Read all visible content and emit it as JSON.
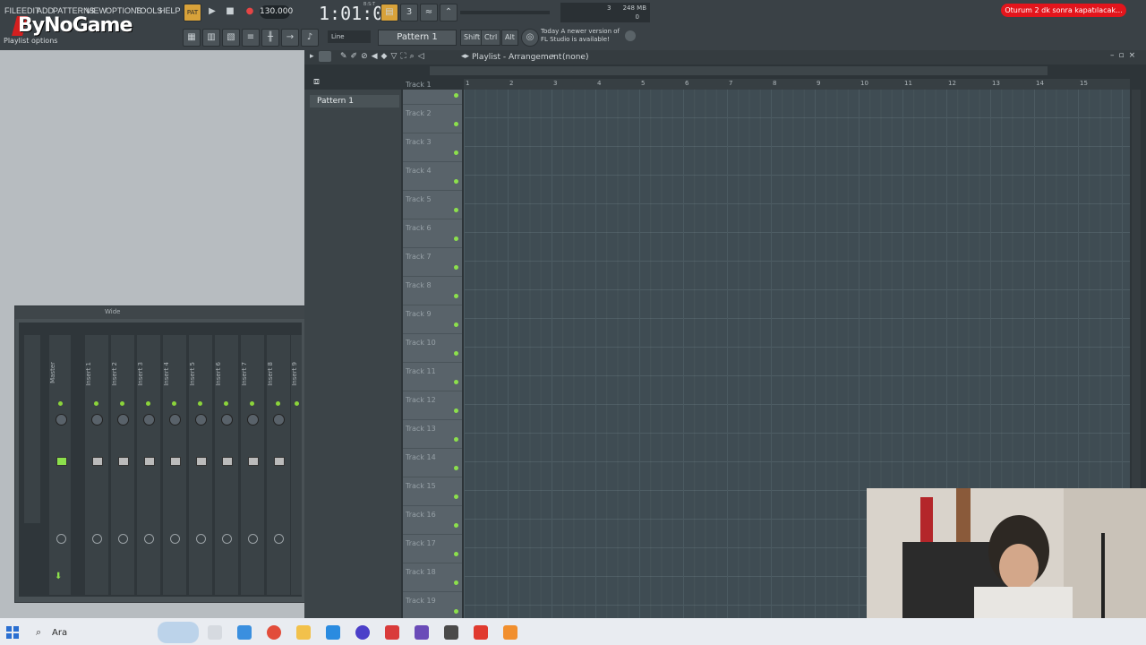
{
  "menu": [
    "FILE",
    "EDIT",
    "ADD",
    "PATTERNS",
    "VIEW",
    "OPTIONS",
    "TOOLS",
    "HELP"
  ],
  "brand": "ByNoGame",
  "hint": "Playlist options",
  "tempo": "130.000",
  "clock": "1:01:00",
  "clock_sub": "B:S:T",
  "cpu": {
    "num": "3",
    "mem": "248 MB",
    "zero": "0"
  },
  "notice": "Oturum 2 dk sonra kapatılacak...",
  "snap": "Line",
  "pattern_select": "Pattern 1",
  "keys": [
    "Shift",
    "Ctrl",
    "Alt"
  ],
  "update_msg": [
    "Today  A newer version of",
    "FL Studio is available!"
  ],
  "playlist": {
    "title": "Playlist - Arrangement",
    "arrangement": "(none)",
    "pattern": "Pattern 1"
  },
  "bars": [
    "1",
    "2",
    "3",
    "4",
    "5",
    "6",
    "7",
    "8",
    "9",
    "10",
    "11",
    "12",
    "13",
    "14",
    "15"
  ],
  "tracks": [
    "Track 1",
    "Track 2",
    "Track 3",
    "Track 4",
    "Track 5",
    "Track 6",
    "Track 7",
    "Track 8",
    "Track 9",
    "Track 10",
    "Track 11",
    "Track 12",
    "Track 13",
    "Track 14",
    "Track 15",
    "Track 16",
    "Track 17",
    "Track 18",
    "Track 19"
  ],
  "mixer": {
    "title": "Wide",
    "master": "Master",
    "inserts": [
      "Insert 1",
      "Insert 2",
      "Insert 3",
      "Insert 4",
      "Insert 5",
      "Insert 6",
      "Insert 7",
      "Insert 8",
      "Insert 9"
    ]
  },
  "taskbar": {
    "search_text": "Ara"
  },
  "colors": {
    "accent_red": "#e3151c",
    "grid": "#3f4c53",
    "led_green": "#8ce04c"
  }
}
